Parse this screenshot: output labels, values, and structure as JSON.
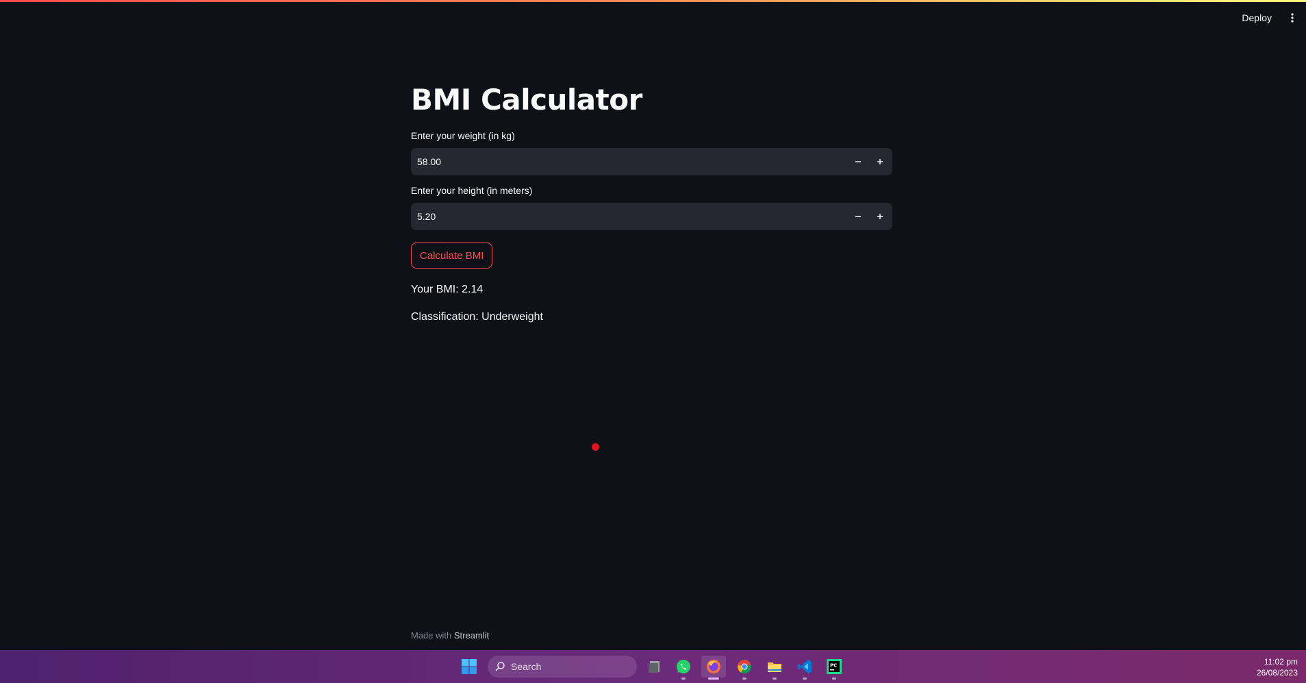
{
  "toolbar": {
    "deploy_label": "Deploy",
    "menu_icon": "more-vertical-icon"
  },
  "main": {
    "title": "BMI Calculator",
    "weight": {
      "label": "Enter your weight (in kg)",
      "value": "58.00"
    },
    "height": {
      "label": "Enter your height (in meters)",
      "value": "5.20"
    },
    "calculate_button": "Calculate BMI",
    "bmi_result": "Your BMI: 2.14",
    "classification_result": "Classification: Underweight"
  },
  "footer": {
    "prefix": "Made with",
    "brand": "Streamlit"
  },
  "taskbar": {
    "search_label": "Search",
    "apps": [
      "file-manager-icon",
      "whatsapp-icon",
      "firefox-icon",
      "chrome-icon",
      "file-explorer-icon",
      "vscode-icon",
      "pycharm-icon"
    ],
    "time": "11:02 pm",
    "date": "26/08/2023"
  },
  "colors": {
    "background": "#0e1117",
    "input_background": "#262730",
    "primary": "#ff4b4b",
    "taskbar": "#5c2474"
  }
}
